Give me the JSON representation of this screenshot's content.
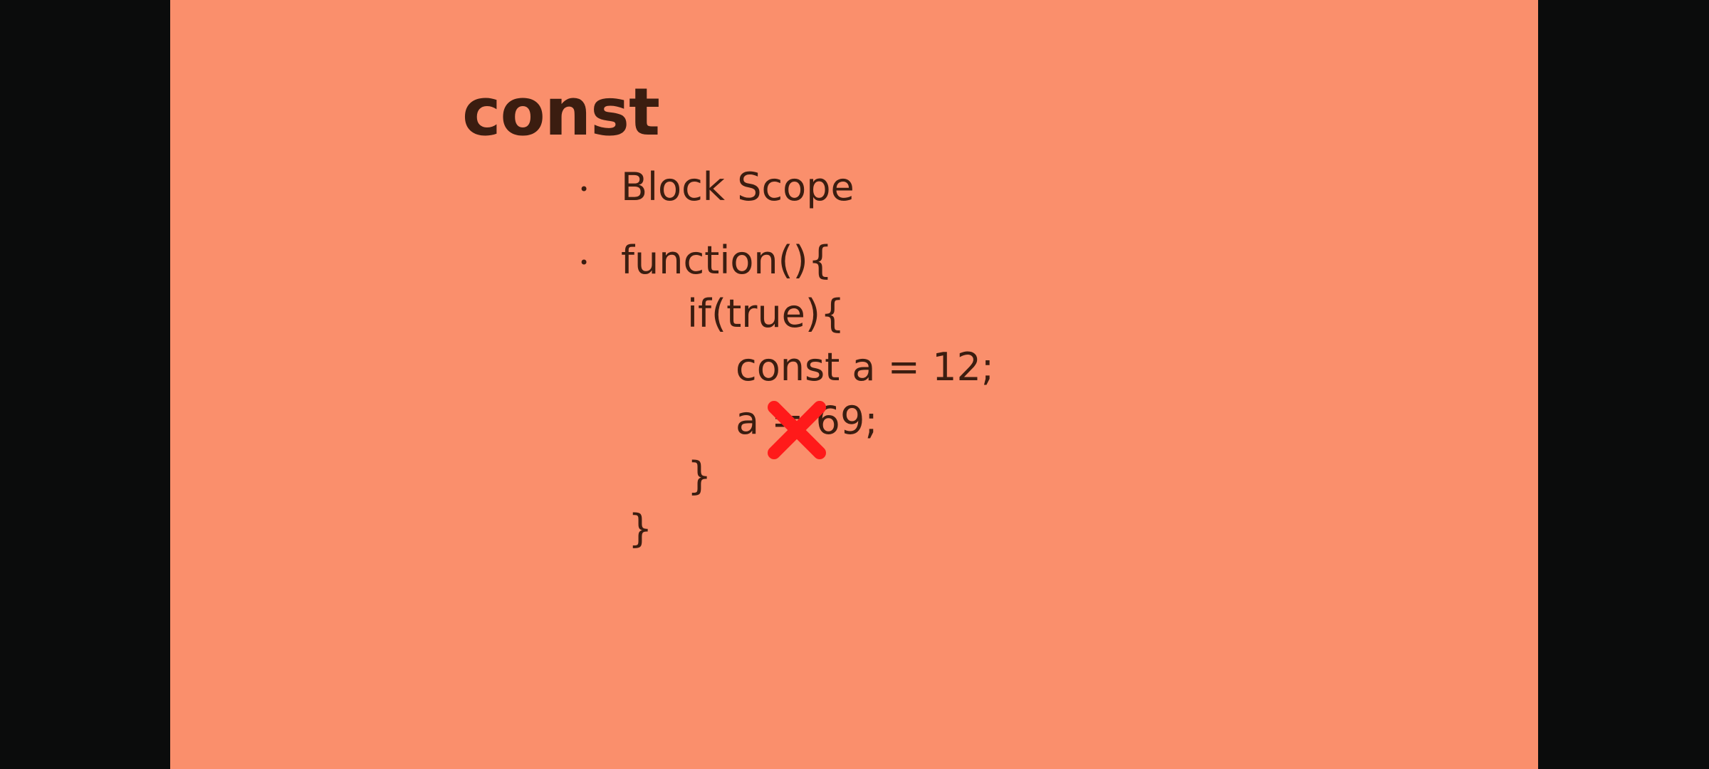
{
  "slide": {
    "background_color": "#fa8f6c",
    "text_color": "#3b1d10",
    "title": "const",
    "bullet_char": "•",
    "bullets": [
      {
        "text": "Block Scope"
      },
      {
        "text": "function(){"
      }
    ],
    "code_lines": [
      "if(true){",
      "const a = 12;",
      "a = 69;",
      "}",
      "}"
    ],
    "error_mark": {
      "icon": "x-mark-icon",
      "color": "#ff1a1a"
    }
  }
}
